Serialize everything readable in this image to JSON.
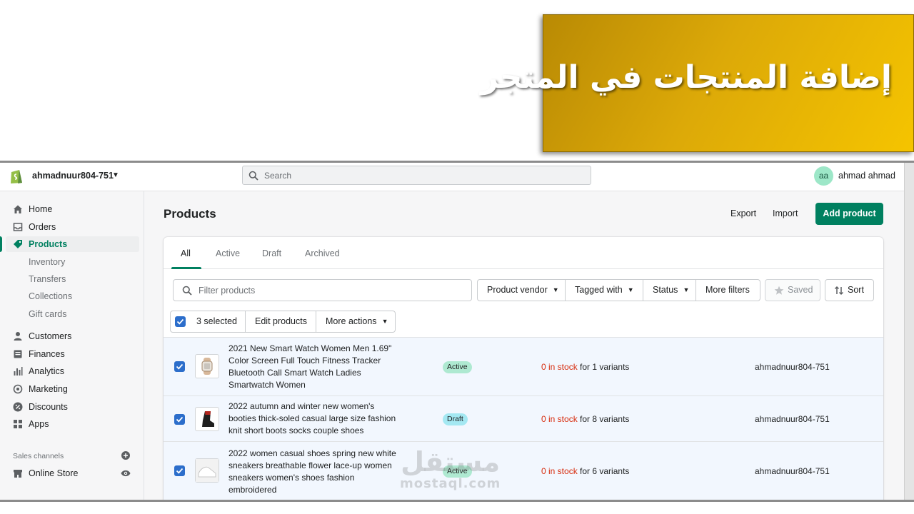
{
  "banner": {
    "title": "إضافة المنتجات في المتجر"
  },
  "topbar": {
    "store_name": "ahmadnuur804-751",
    "search_placeholder": "Search",
    "avatar_initials": "aa",
    "user_name": "ahmad ahmad"
  },
  "sidebar": {
    "items": [
      {
        "label": "Home",
        "icon": "home-icon"
      },
      {
        "label": "Orders",
        "icon": "orders-icon"
      },
      {
        "label": "Products",
        "icon": "tag-icon",
        "active": true
      },
      {
        "label": "Inventory"
      },
      {
        "label": "Transfers"
      },
      {
        "label": "Collections"
      },
      {
        "label": "Gift cards"
      },
      {
        "label": "Customers",
        "icon": "person-icon"
      },
      {
        "label": "Finances",
        "icon": "finances-icon"
      },
      {
        "label": "Analytics",
        "icon": "bar-chart-icon"
      },
      {
        "label": "Marketing",
        "icon": "target-icon"
      },
      {
        "label": "Discounts",
        "icon": "discount-icon"
      },
      {
        "label": "Apps",
        "icon": "apps-icon"
      }
    ],
    "sales_channels_label": "Sales channels",
    "online_store_label": "Online Store"
  },
  "header": {
    "title": "Products",
    "export_label": "Export",
    "import_label": "Import",
    "add_product_label": "Add product"
  },
  "tabs": [
    "All",
    "Active",
    "Draft",
    "Archived"
  ],
  "filters": {
    "placeholder": "Filter products",
    "vendor_label": "Product vendor",
    "tagged_label": "Tagged with",
    "status_label": "Status",
    "more_filters_label": "More filters",
    "saved_label": "Saved",
    "sort_label": "Sort"
  },
  "bulk": {
    "selected_label": "3 selected",
    "edit_label": "Edit products",
    "more_actions_label": "More actions"
  },
  "products": [
    {
      "name": "2021 New Smart Watch Women Men 1.69\" Color Screen Full Touch Fitness Tracker Bluetooth Call Smart Watch Ladies Smartwatch Women",
      "status": "Active",
      "stock_red": "0 in stock",
      "stock_rest": " for 1 variants",
      "vendor": "ahmadnuur804-751",
      "checked": true
    },
    {
      "name": "2022 autumn and winter new women's booties thick-soled casual large size fashion knit short boots socks couple shoes",
      "status": "Draft",
      "stock_red": "0 in stock",
      "stock_rest": " for 8 variants",
      "vendor": "ahmadnuur804-751",
      "checked": true
    },
    {
      "name": "2022 women casual shoes spring new white sneakers breathable flower lace-up women sneakers women's shoes fashion embroidered",
      "status": "Active",
      "stock_red": "0 in stock",
      "stock_rest": " for 6 variants",
      "vendor": "ahmadnuur804-751",
      "checked": true
    }
  ],
  "watermark": {
    "arabic": "مستقل",
    "latin": "mostaql.com"
  },
  "colors": {
    "brand_green": "#008060",
    "banner_gold": "#dca908",
    "selected_blue": "#2c6ecb",
    "stock_red": "#d72c0d"
  }
}
